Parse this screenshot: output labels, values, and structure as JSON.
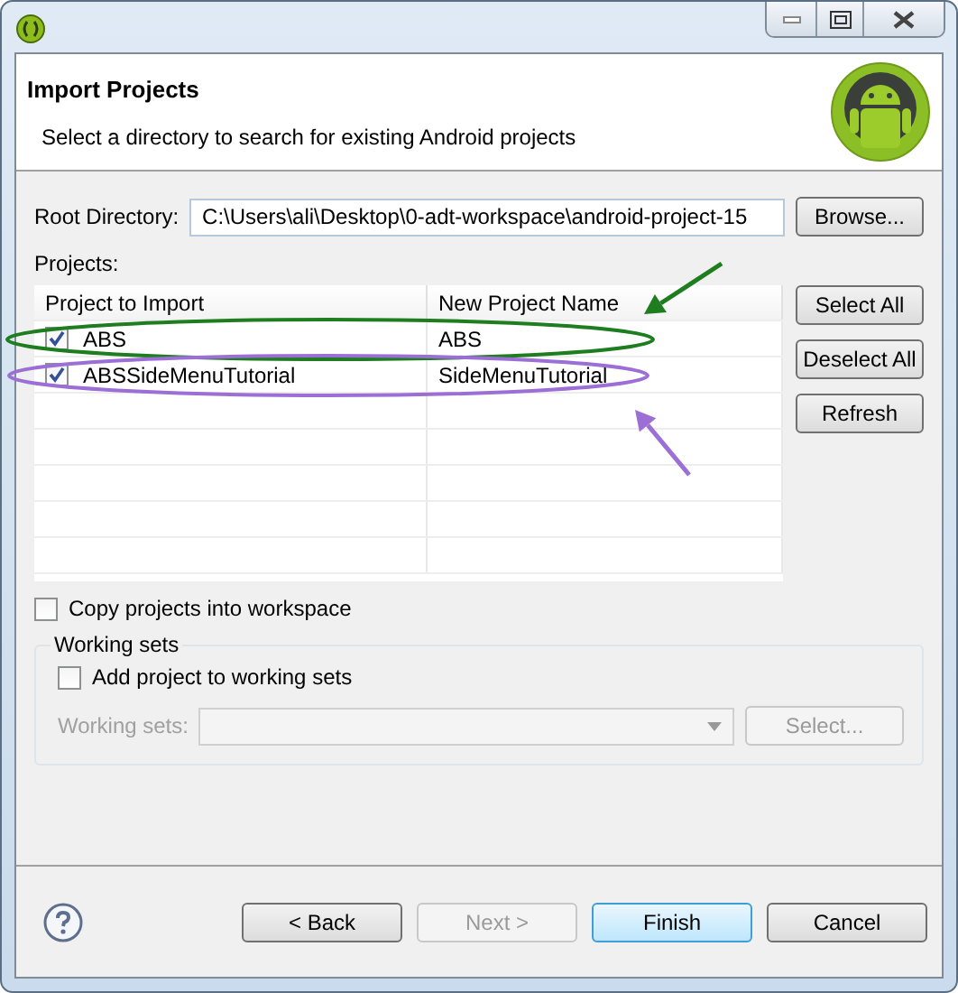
{
  "header": {
    "title": "Import Projects",
    "subtitle": "Select a directory to search for existing Android projects"
  },
  "root_directory": {
    "label": "Root Directory:",
    "value": "C:\\Users\\ali\\Desktop\\0-adt-workspace\\android-project-15",
    "button": "Browse..."
  },
  "projects": {
    "label": "Projects:",
    "columns": [
      "Project to Import",
      "New Project Name"
    ],
    "rows": [
      {
        "project": "ABS",
        "new_name": "ABS",
        "checked": true
      },
      {
        "project": "ABSSideMenuTutorial",
        "new_name": "SideMenuTutorial",
        "checked": true
      }
    ],
    "buttons": [
      "Select All",
      "Deselect All",
      "Refresh"
    ]
  },
  "annotations": [
    {
      "color": "#1e7d1e"
    },
    {
      "color": "#9b6fd6"
    }
  ],
  "copy_projects": {
    "label": "Copy projects into workspace",
    "checked": false
  },
  "working_sets": {
    "title": "Working sets",
    "add": {
      "label": "Add project to working sets",
      "checked": false
    },
    "field_label": "Working sets:",
    "disabled": true,
    "button": "Select..."
  },
  "footer_buttons": [
    {
      "label": "< Back",
      "disabled": false,
      "default": false
    },
    {
      "label": "Next >",
      "disabled": true,
      "default": false
    },
    {
      "label": "Finish",
      "disabled": false,
      "default": true
    },
    {
      "label": "Cancel",
      "disabled": false,
      "default": false
    }
  ]
}
